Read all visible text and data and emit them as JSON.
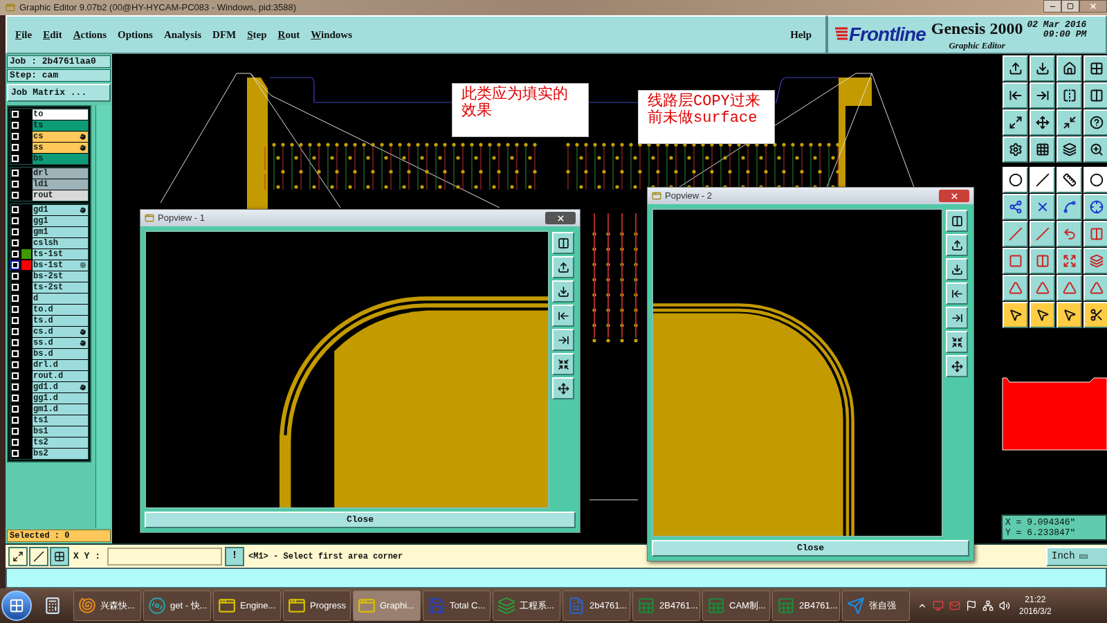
{
  "window": {
    "title": "Graphic Editor 9.07b2 (00@HY-HYCAM-PC083 - Windows, pid:3588)"
  },
  "menu": [
    {
      "label": "File",
      "mnemonic": true
    },
    {
      "label": "Edit",
      "mnemonic": true
    },
    {
      "label": "Actions",
      "mnemonic": true
    },
    {
      "label": "Options",
      "mnemonic": false
    },
    {
      "label": "Analysis",
      "mnemonic": false
    },
    {
      "label": "DFM",
      "mnemonic": false
    },
    {
      "label": "Step",
      "mnemonic": true
    },
    {
      "label": "Rout",
      "mnemonic": true
    },
    {
      "label": "Windows",
      "mnemonic": true
    }
  ],
  "help_menu": "Help",
  "brand": {
    "logo": "Frontline",
    "product": "Genesis 2000",
    "subtitle": "Graphic Editor",
    "date": "02 Mar 2016",
    "time": "09:00 PM"
  },
  "job_panel": {
    "job": "Job : 2b4761laa0",
    "step": "Step: cam",
    "matrix_button": "Job Matrix ...",
    "selected_count": "Selected : 0"
  },
  "layer_groups": [
    [
      {
        "name": "to",
        "color": "#ffffff",
        "selected": false,
        "hand": false,
        "grid": false
      },
      {
        "name": "ts",
        "color": "#0d9c78",
        "selected": false,
        "hand": false,
        "grid": false
      },
      {
        "name": "cs",
        "color": "#ffc85a",
        "selected": false,
        "hand": true,
        "grid": false
      },
      {
        "name": "ss",
        "color": "#ffc85a",
        "selected": false,
        "hand": true,
        "grid": false
      },
      {
        "name": "bs",
        "color": "#0d9c78",
        "selected": false,
        "hand": false,
        "grid": false
      }
    ],
    [
      {
        "name": "drl",
        "color": "#9db3b8",
        "selected": false,
        "hand": false,
        "grid": false
      },
      {
        "name": "ldi",
        "color": "#9db3b8",
        "selected": false,
        "hand": false,
        "grid": false
      },
      {
        "name": "rout",
        "color": "#d8d8d8",
        "selected": false,
        "hand": false,
        "grid": false
      }
    ],
    [
      {
        "name": "gd1",
        "color": "#9ddcdc",
        "selected": false,
        "hand": true,
        "grid": false
      },
      {
        "name": "gg1",
        "color": "#9ddcdc",
        "selected": false,
        "hand": false,
        "grid": false
      },
      {
        "name": "gm1",
        "color": "#9ddcdc",
        "selected": false,
        "hand": false,
        "grid": false
      },
      {
        "name": "cslsh",
        "color": "#9ddcdc",
        "selected": false,
        "hand": false,
        "grid": false
      },
      {
        "name": "ts-1st",
        "color": "#9ddcdc",
        "selected": false,
        "hand": false,
        "grid": false,
        "swatch": {
          "color": "#3f9a00"
        }
      },
      {
        "name": "bs-1st",
        "color": "#9ddcdc",
        "selected": true,
        "hand": false,
        "grid": true,
        "swatch": {
          "color": "#ff0000"
        }
      },
      {
        "name": "bs-2st",
        "color": "#9ddcdc",
        "selected": false,
        "hand": false,
        "grid": false
      },
      {
        "name": "ts-2st",
        "color": "#9ddcdc",
        "selected": false,
        "hand": false,
        "grid": false
      },
      {
        "name": "d",
        "color": "#9ddcdc",
        "selected": false,
        "hand": false,
        "grid": false
      },
      {
        "name": "to.d",
        "color": "#9ddcdc",
        "selected": false,
        "hand": false,
        "grid": false
      },
      {
        "name": "ts.d",
        "color": "#9ddcdc",
        "selected": false,
        "hand": false,
        "grid": false
      },
      {
        "name": "cs.d",
        "color": "#9ddcdc",
        "selected": false,
        "hand": true,
        "grid": false
      },
      {
        "name": "ss.d",
        "color": "#9ddcdc",
        "selected": false,
        "hand": true,
        "grid": false
      },
      {
        "name": "bs.d",
        "color": "#9ddcdc",
        "selected": false,
        "hand": false,
        "grid": false
      },
      {
        "name": "drl.d",
        "color": "#9ddcdc",
        "selected": false,
        "hand": false,
        "grid": false
      },
      {
        "name": "rout.d",
        "color": "#9ddcdc",
        "selected": false,
        "hand": false,
        "grid": false
      },
      {
        "name": "gd1.d",
        "color": "#9ddcdc",
        "selected": false,
        "hand": true,
        "grid": false
      },
      {
        "name": "gg1.d",
        "color": "#9ddcdc",
        "selected": false,
        "hand": false,
        "grid": false
      },
      {
        "name": "gm1.d",
        "color": "#9ddcdc",
        "selected": false,
        "hand": false,
        "grid": false
      },
      {
        "name": "ts1",
        "color": "#9ddcdc",
        "selected": false,
        "hand": false,
        "grid": false
      },
      {
        "name": "bs1",
        "color": "#9ddcdc",
        "selected": false,
        "hand": false,
        "grid": false
      },
      {
        "name": "ts2",
        "color": "#9ddcdc",
        "selected": false,
        "hand": false,
        "grid": false
      },
      {
        "name": "bs2",
        "color": "#9ddcdc",
        "selected": false,
        "hand": false,
        "grid": false
      }
    ]
  ],
  "annotations": [
    "此类应为填实的效果",
    "线路层COPY过来前未做surface"
  ],
  "popviews": [
    {
      "title": "Popview - 1",
      "close_label": "Close",
      "active": false
    },
    {
      "title": "Popview - 2",
      "close_label": "Close",
      "active": true
    }
  ],
  "coords": {
    "x": "X = 9.094346\"",
    "y": "Y = 6.233847\""
  },
  "status": {
    "xy_label": "X Y :",
    "alert": "!",
    "message": "<M1> - Select first area corner",
    "units": "Inch"
  },
  "taskbar": {
    "items": [
      {
        "label": "兴森快...",
        "kind": "shell",
        "selected": false
      },
      {
        "label": "get - 快...",
        "kind": "disc",
        "selected": false
      },
      {
        "label": "Engine...",
        "kind": "window",
        "selected": false
      },
      {
        "label": "Progress",
        "kind": "window",
        "selected": false
      },
      {
        "label": "Graphi...",
        "kind": "window",
        "selected": true
      },
      {
        "label": "Total C...",
        "kind": "floppy",
        "selected": false
      },
      {
        "label": "工程系...",
        "kind": "layers",
        "selected": false
      },
      {
        "label": "2b4761...",
        "kind": "document",
        "selected": false
      },
      {
        "label": "2B4761...",
        "kind": "sheet",
        "selected": false
      },
      {
        "label": "CAM制...",
        "kind": "sheet",
        "selected": false
      },
      {
        "label": "2B4761...",
        "kind": "sheet",
        "selected": false
      },
      {
        "label": "张自强",
        "kind": "send",
        "selected": false
      }
    ],
    "clock": {
      "time": "21:22",
      "date": "2016/3/2"
    }
  }
}
